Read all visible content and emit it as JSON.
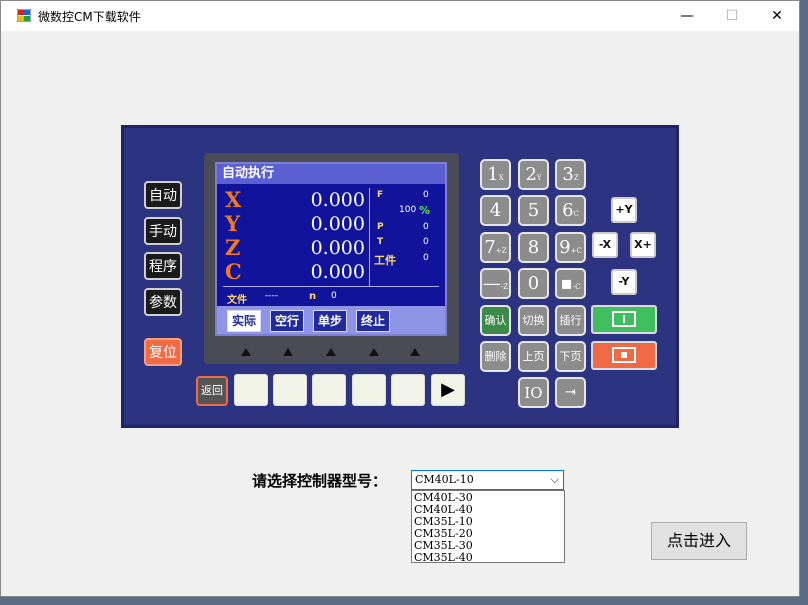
{
  "window": {
    "title": "微数控CM下载软件",
    "minimize": "—",
    "maximize": "☐",
    "close": "✕"
  },
  "device": {
    "side_buttons": [
      "自动",
      "手动",
      "程序",
      "参数"
    ],
    "reset_button": "复位",
    "screen": {
      "title": "自动执行",
      "axes": [
        {
          "label": "X",
          "value": "0.000"
        },
        {
          "label": "Y",
          "value": "0.000"
        },
        {
          "label": "Z",
          "value": "0.000"
        },
        {
          "label": "C",
          "value": "0.000"
        }
      ],
      "status": [
        {
          "label": "F",
          "value": "0"
        },
        {
          "label": "%",
          "value": "100"
        },
        {
          "label": "P",
          "value": "0"
        },
        {
          "label": "T",
          "value": "0"
        },
        {
          "label": "工件",
          "value": "0"
        }
      ],
      "file_label": "文件",
      "file_value": "----",
      "n_label": "n",
      "n_value": "0",
      "softkeys": [
        "实际",
        "空行",
        "单步",
        "终止"
      ]
    },
    "back_button": "返回",
    "play_icon": "play-icon",
    "keypad": [
      {
        "main": "1",
        "sub": "X"
      },
      {
        "main": "2",
        "sub": "Y"
      },
      {
        "main": "3",
        "sub": "Z"
      },
      {
        "main": "4",
        "sub": ""
      },
      {
        "main": "5",
        "sub": ""
      },
      {
        "main": "6",
        "sub": "C"
      },
      {
        "main": "7",
        "sub": "+Z"
      },
      {
        "main": "8",
        "sub": ""
      },
      {
        "main": "9",
        "sub": "+C"
      },
      {
        "main": "—",
        "sub": "-Z"
      },
      {
        "main": "0",
        "sub": ""
      },
      {
        "main": "▪",
        "sub": "-C"
      }
    ],
    "func_keys": [
      "确认",
      "切换",
      "插行",
      "删除",
      "上页",
      "下页",
      "IO"
    ],
    "jog_keys": [
      "+Y",
      "-X",
      "X+",
      "-Y"
    ],
    "colors": {
      "start": "#3fbf60",
      "stop": "#f06b45",
      "panel": "#2c3482",
      "screen": "#11149b"
    }
  },
  "form": {
    "prompt": "请选择控制器型号：",
    "selected": "CM40L-10",
    "options": [
      "CM40L-30",
      "CM40L-40",
      "CM35L-10",
      "CM35L-20",
      "CM35L-30",
      "CM35L-40"
    ],
    "enter_button": "点击进入"
  }
}
